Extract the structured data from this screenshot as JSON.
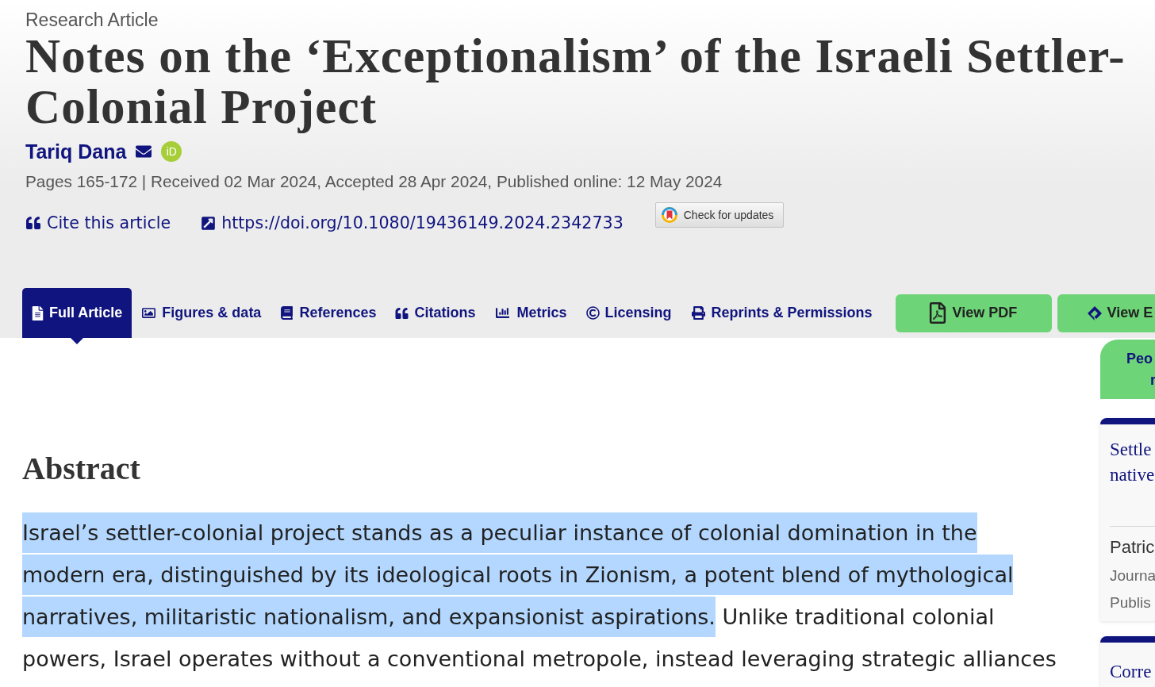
{
  "header": {
    "article_type": "Research Article",
    "title": "Notes on the ‘Exceptionalism’ of the Israeli Settler-Colonial Project",
    "author": {
      "name": "Tariq Dana",
      "orcid_label": "iD"
    },
    "meta": "Pages 165-172 | Received 02 Mar 2024, Accepted 28 Apr 2024, Published online: 12 May 2024",
    "links": [
      {
        "kind": "cite",
        "label": "Cite this article"
      },
      {
        "kind": "doi",
        "label": "https://doi.org/10.1080/19436149.2024.2342733"
      }
    ],
    "update_button": "Check for updates"
  },
  "tabs": [
    {
      "label": "Full Article",
      "selected": true
    },
    {
      "label": "Figures & data",
      "selected": false
    },
    {
      "label": "References",
      "selected": false
    },
    {
      "label": "Citations",
      "selected": false
    },
    {
      "label": "Metrics",
      "selected": false
    },
    {
      "label": "Licensing",
      "selected": false
    },
    {
      "label": "Reprints & Permissions",
      "selected": false
    }
  ],
  "buttons": [
    {
      "label": "View PDF"
    },
    {
      "label": "View E"
    }
  ],
  "abstract": {
    "heading": "Abstract",
    "segments": [
      {
        "text": "Israel’s settler-colonial project stands as a peculiar instance of colonial domination in the modern era, distinguished by its ideological roots in Zionism, a potent blend of mythological narratives, militaristic nationalism, and expansionist aspirations.",
        "selected": true
      },
      {
        "text": "Unlike traditional colonial powers, Israel operates without a conventional metropole, instead leveraging strategic alliances",
        "selected": false
      }
    ]
  },
  "sidebar": {
    "tab_lines": [
      "Peo",
      "r"
    ],
    "cards": [
      {
        "title_lines": [
          "Settle",
          "native"
        ],
        "author": "Patric",
        "details": [
          "Journa",
          "Publis"
        ]
      },
      {
        "title_lines": [
          "Corre"
        ]
      }
    ]
  }
}
